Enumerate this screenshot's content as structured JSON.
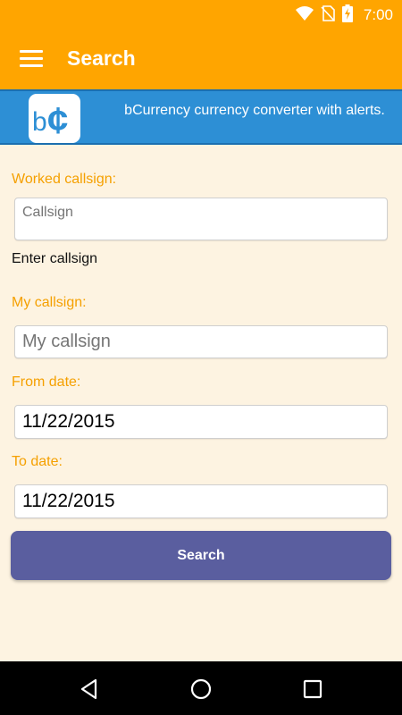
{
  "status_bar": {
    "time": "7:00",
    "icons": [
      "wifi-icon",
      "no-sim-icon",
      "battery-charging-icon"
    ]
  },
  "app_bar": {
    "title": "Search",
    "menu_icon": "hamburger-menu-icon"
  },
  "banner": {
    "logo_text": "b¢",
    "text": "bCurrency currency converter with alerts.",
    "colors": {
      "background": "#2d8fd5",
      "logo_glyph": "#2d8fd5"
    }
  },
  "form": {
    "worked_callsign": {
      "label": "Worked callsign:",
      "placeholder": "Callsign",
      "value": "",
      "helper": "Enter callsign"
    },
    "my_callsign": {
      "label": "My callsign:",
      "placeholder": "My callsign",
      "value": ""
    },
    "from_date": {
      "label": "From date:",
      "value": "11/22/2015"
    },
    "to_date": {
      "label": "To date:",
      "value": "11/22/2015"
    },
    "search_button": "Search"
  },
  "nav_bar": {
    "icons": [
      "back-icon",
      "home-icon",
      "recents-icon"
    ]
  },
  "colors": {
    "accent": "#ffa500",
    "label": "#f5a000",
    "background": "#fdf3e1",
    "button": "#5a5e9f"
  }
}
